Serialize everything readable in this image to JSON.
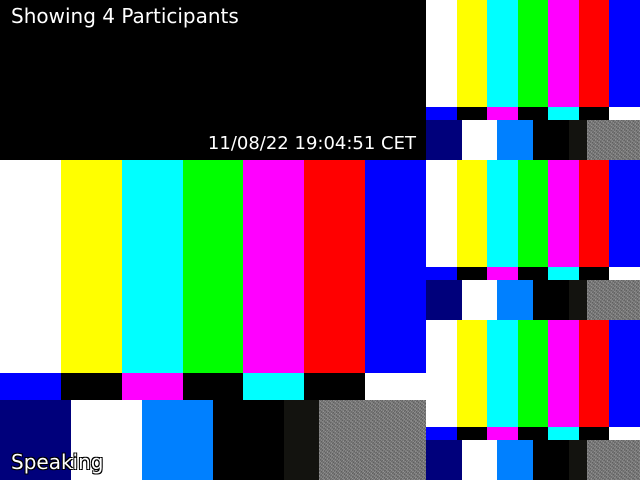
{
  "header": {
    "participants_text": "Showing 4 Participants",
    "timestamp": "11/08/22 19:04:51 CET"
  },
  "main_tile": {
    "status_label": "Speaking"
  },
  "colors": {
    "bars_top": [
      "#ffffff",
      "#ffff00",
      "#00ffff",
      "#00ff00",
      "#ff00ff",
      "#ff0000",
      "#0000ff"
    ],
    "bars_mid": [
      "#0000ff",
      "#000000",
      "#ff00ff",
      "#000000",
      "#00ffff",
      "#000000",
      "#ffffff"
    ],
    "pattern": [
      "#00007b",
      "#ffffff",
      "#0080ff",
      "#000000",
      "#13130f",
      "#7a7a7a"
    ]
  },
  "participant_tiles": [
    {
      "id": "participant-1",
      "speaking": true
    },
    {
      "id": "participant-2",
      "speaking": false
    },
    {
      "id": "participant-3",
      "speaking": false
    },
    {
      "id": "participant-4",
      "speaking": false
    }
  ]
}
